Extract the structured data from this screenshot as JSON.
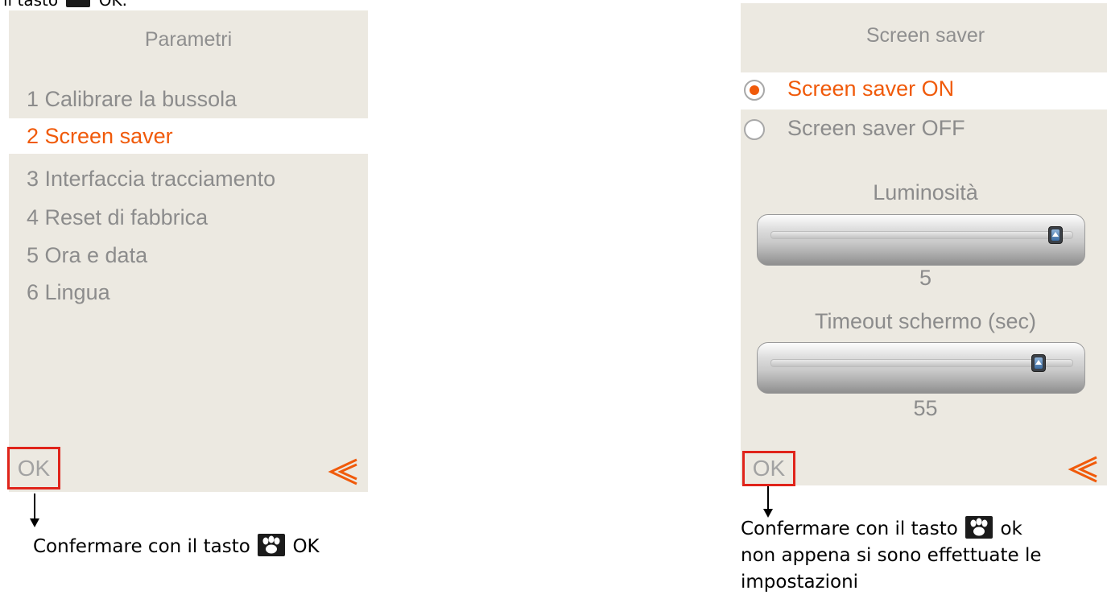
{
  "top_fragment": {
    "before": "il tasto",
    "after": "OK."
  },
  "left_screen": {
    "title": "Parametri",
    "menu_items": [
      "1 Calibrare la bussola",
      "2 Screen saver",
      "3 Interfaccia tracciamento",
      "4 Reset di fabbrica",
      "5 Ora e data",
      "6 Lingua"
    ],
    "selected_index": 1,
    "ok_label": "OK"
  },
  "right_screen": {
    "title": "Screen saver",
    "options": [
      {
        "label": "Screen saver ON",
        "selected": true
      },
      {
        "label": "Screen saver OFF",
        "selected": false
      }
    ],
    "brightness": {
      "label": "Luminosità",
      "value": "5",
      "level_fraction": 0.98
    },
    "timeout": {
      "label": "Timeout schermo (sec)",
      "value": "55",
      "level_fraction": 0.92
    },
    "ok_label": "OK"
  },
  "annotations": {
    "left_caption": {
      "before": "Confermare con il tasto",
      "after": "OK"
    },
    "right_caption": {
      "line1_before": "Confermare con il tasto",
      "line1_after": "ok",
      "line2": "non appena si sono effettuate le",
      "line3": "impostazioni"
    }
  },
  "colors": {
    "accent": "#f05a0a",
    "screen_bg": "#ece9e1",
    "muted_text": "#8c8c8c",
    "highlight_box": "#e0241b"
  },
  "icons": {
    "back": "double-chevron-left-icon",
    "key": "paw-key-icon"
  }
}
